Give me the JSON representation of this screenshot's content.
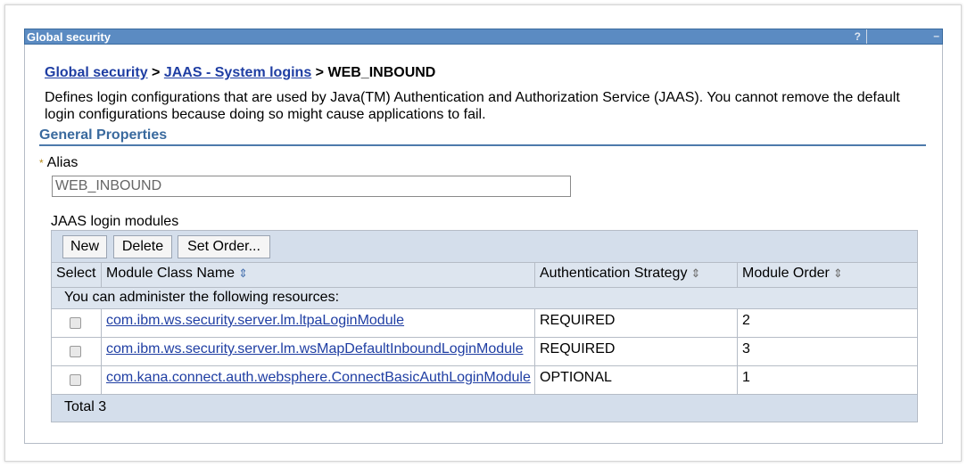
{
  "window": {
    "title": "Global security",
    "help_label": "?",
    "min_label": "–"
  },
  "breadcrumb": {
    "items": [
      "Global security",
      "JAAS - System logins"
    ],
    "separator": ">",
    "current": "WEB_INBOUND"
  },
  "description": "Defines login configurations that are used by Java(TM) Authentication and Authorization Service (JAAS). You cannot remove the default login configurations because doing so might cause applications to fail.",
  "section_title": "General Properties",
  "alias": {
    "required_mark": "*",
    "label": "Alias",
    "value": "WEB_INBOUND"
  },
  "modules": {
    "label": "JAAS login modules",
    "buttons": {
      "new": "New",
      "delete": "Delete",
      "set_order": "Set Order..."
    },
    "columns": [
      "Select",
      "Module Class Name",
      "Authentication Strategy",
      "Module Order"
    ],
    "message": "You can administer the following resources:",
    "rows": [
      {
        "class_name": "com.ibm.ws.security.server.lm.ltpaLoginModule",
        "strategy": "REQUIRED",
        "order": "2"
      },
      {
        "class_name": "com.ibm.ws.security.server.lm.wsMapDefaultInboundLoginModule",
        "strategy": "REQUIRED",
        "order": "3"
      },
      {
        "class_name": "com.kana.connect.auth.websphere.ConnectBasicAuthLoginModule",
        "strategy": "OPTIONAL",
        "order": "1"
      }
    ],
    "total": "Total 3"
  },
  "colors": {
    "title_bar": "#5b8bc2",
    "link": "#1f3ea3",
    "section": "#3a6a9e",
    "table_header": "#dde5ef"
  }
}
